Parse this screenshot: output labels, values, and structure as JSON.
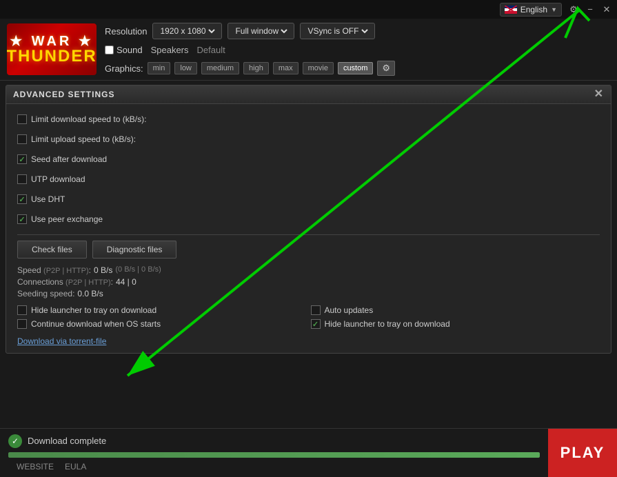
{
  "topbar": {
    "language": "English",
    "lang_code": "EN"
  },
  "winControls": {
    "minimize": "−",
    "close": "✕",
    "settings": "⚙"
  },
  "header": {
    "logo": {
      "line1": "★ WAR ★",
      "line2": "THUNDER"
    },
    "resolution_label": "Resolution",
    "resolution_value": "1920 x 1080",
    "window_mode_value": "Full window",
    "vsync_value": "VSync is OFF",
    "sound_label": "Sound",
    "sound_checked": false,
    "speakers_label": "Speakers",
    "default_label": "Default",
    "graphics_label": "Graphics:",
    "graphics_options": [
      "min",
      "low",
      "medium",
      "high",
      "max",
      "movie",
      "custom"
    ]
  },
  "advancedSettings": {
    "title": "ADVANCED SETTINGS",
    "settings": [
      {
        "label": "Limit download speed to (kB/s):",
        "checked": false
      },
      {
        "label": "Limit upload speed to (kB/s):",
        "checked": false
      },
      {
        "label": "Seed after download",
        "checked": true
      },
      {
        "label": "UTP download",
        "checked": false
      },
      {
        "label": "Use DHT",
        "checked": true
      },
      {
        "label": "Use peer exchange",
        "checked": true
      }
    ],
    "buttons": {
      "check_files": "Check files",
      "diagnostic_files": "Diagnostic files"
    },
    "stats": {
      "speed_label": "Speed",
      "speed_sub": "(P2P | HTTP)",
      "speed_value": "0 B/s",
      "speed_detail": "(0 B/s | 0 B/s)",
      "connections_label": "Connections",
      "connections_sub": "(P2P | HTTP)",
      "connections_value": "44 | 0",
      "seeding_label": "Seeding speed:",
      "seeding_value": "0.0 B/s"
    },
    "options": [
      {
        "label": "Hide launcher to tray on download",
        "checked": false
      },
      {
        "label": "Auto updates",
        "checked": false
      },
      {
        "label": "Continue download when OS starts",
        "checked": false
      },
      {
        "label": "Hide launcher to tray on download",
        "checked": true
      }
    ],
    "torrent_link": "Download via torrent-file"
  },
  "bottomBar": {
    "download_complete": "Download complete",
    "progress": 100,
    "links": [
      {
        "label": "WEBSITE"
      },
      {
        "label": "EULA"
      }
    ],
    "play_button": "PLAY"
  }
}
